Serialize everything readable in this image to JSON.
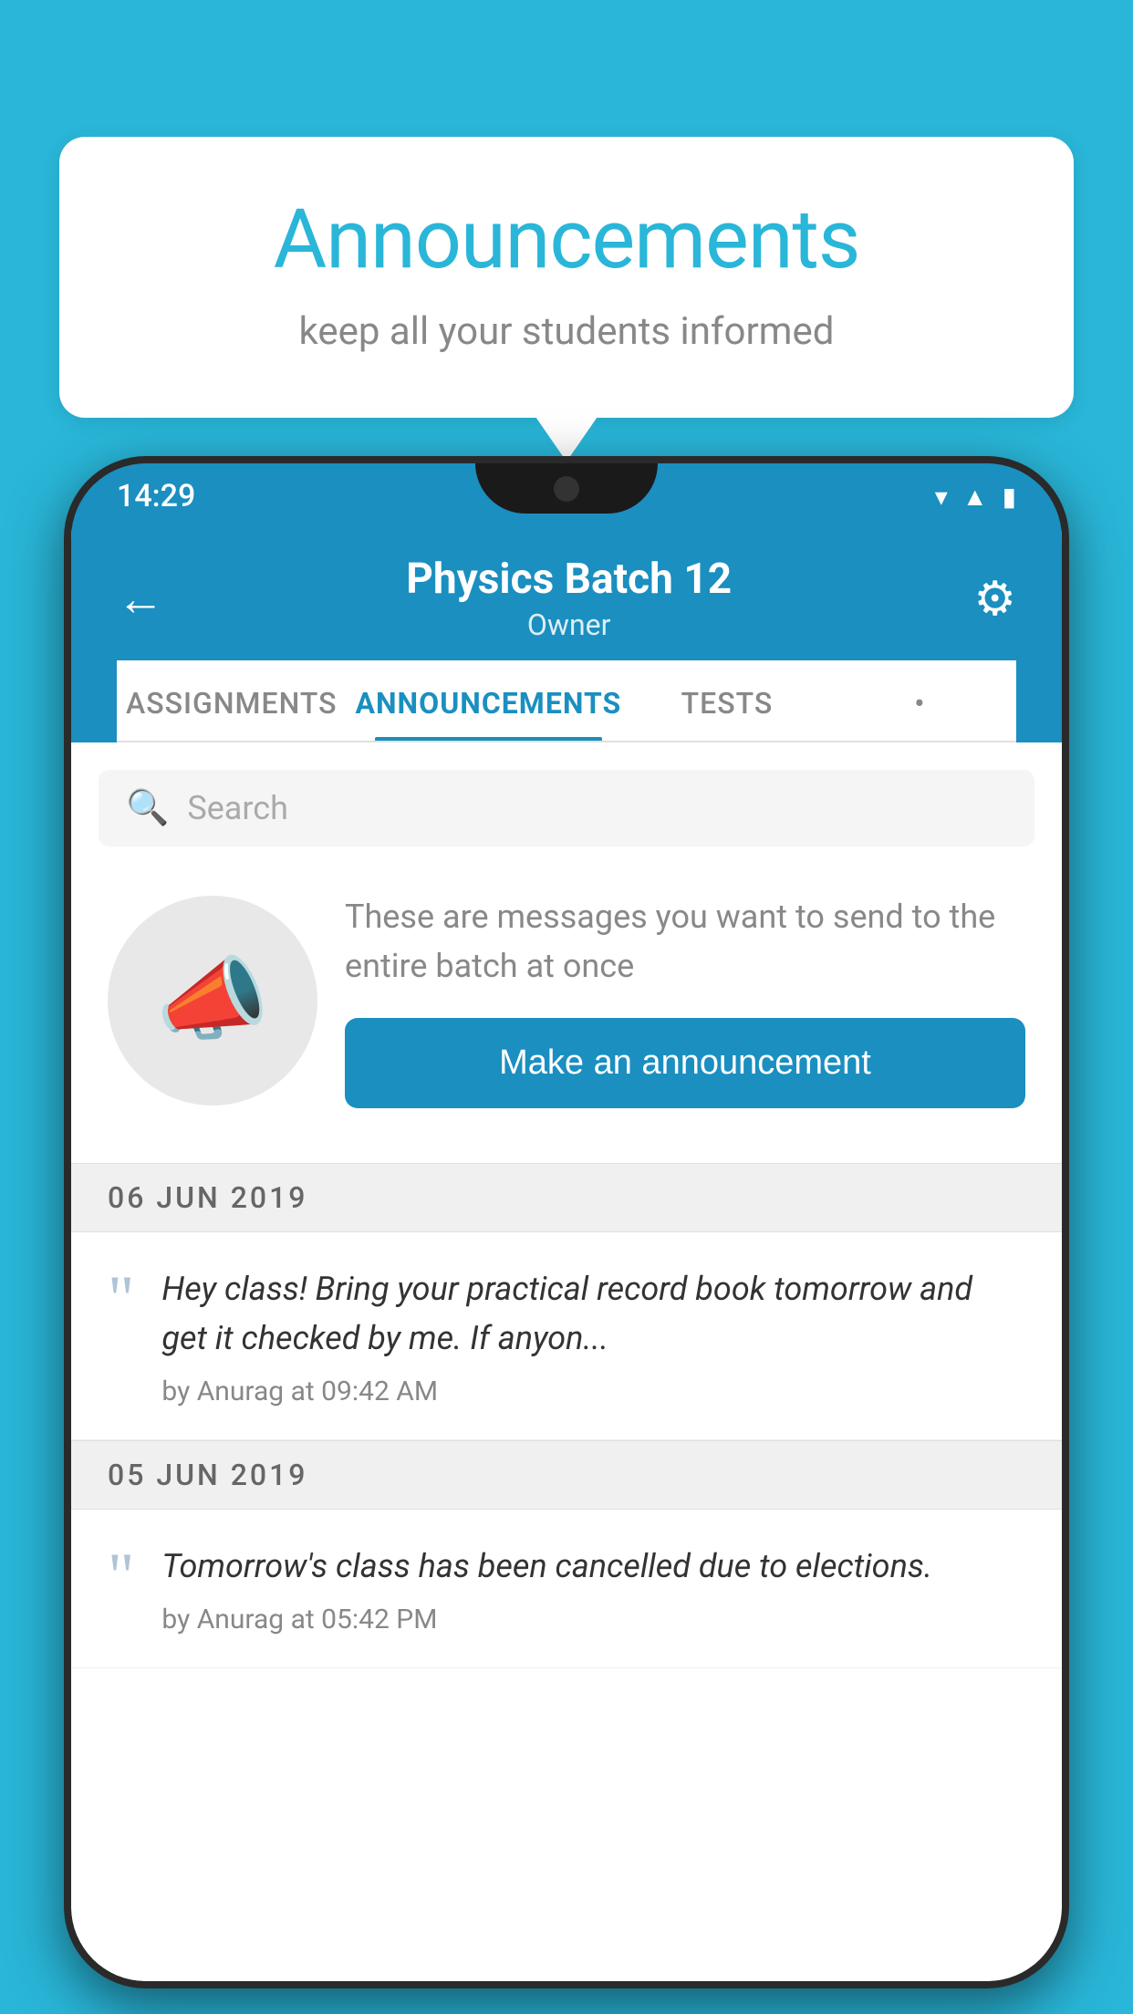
{
  "background_color": "#29b6d8",
  "speech_bubble": {
    "title": "Announcements",
    "subtitle": "keep all your students informed"
  },
  "phone": {
    "status_bar": {
      "time": "14:29"
    },
    "header": {
      "title": "Physics Batch 12",
      "subtitle": "Owner",
      "back_label": "←",
      "gear_label": "⚙"
    },
    "tabs": [
      {
        "label": "ASSIGNMENTS",
        "active": false
      },
      {
        "label": "ANNOUNCEMENTS",
        "active": true
      },
      {
        "label": "TESTS",
        "active": false
      },
      {
        "label": "•",
        "active": false
      }
    ],
    "search": {
      "placeholder": "Search"
    },
    "promo": {
      "description": "These are messages you want to send to the entire batch at once",
      "button_label": "Make an announcement"
    },
    "announcements": [
      {
        "date": "06  JUN  2019",
        "text": "Hey class! Bring your practical record book tomorrow and get it checked by me. If anyon...",
        "meta": "by Anurag at 09:42 AM"
      },
      {
        "date": "05  JUN  2019",
        "text": "Tomorrow's class has been cancelled due to elections.",
        "meta": "by Anurag at 05:42 PM"
      }
    ]
  }
}
